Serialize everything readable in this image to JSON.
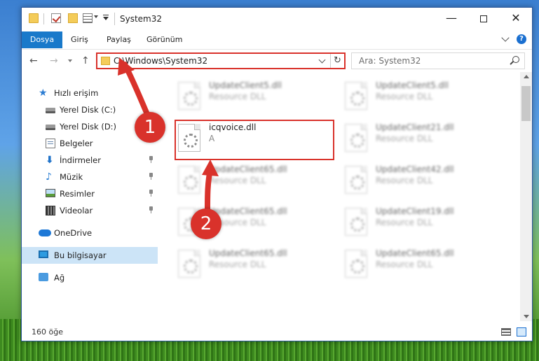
{
  "window": {
    "title": "System32",
    "minimize": "—",
    "close": "✕"
  },
  "ribbon": {
    "tabs": [
      "Dosya",
      "Giriş",
      "Paylaş",
      "Görünüm"
    ],
    "help": "?"
  },
  "address": {
    "path": "C:\\Windows\\System32",
    "refresh": "↻",
    "search_placeholder": "Ara: System32"
  },
  "nav": {
    "back": "←",
    "forward": "→",
    "up": "↑"
  },
  "sidebar": {
    "items": [
      {
        "label": "Hızlı erişim",
        "icon": "star-icon"
      },
      {
        "label": "Yerel Disk (C:)",
        "icon": "drive-icon"
      },
      {
        "label": "Yerel Disk (D:)",
        "icon": "drive-icon"
      },
      {
        "label": "Belgeler",
        "icon": "documents-icon"
      },
      {
        "label": "İndirmeler",
        "icon": "downloads-icon"
      },
      {
        "label": "Müzik",
        "icon": "music-icon"
      },
      {
        "label": "Resimler",
        "icon": "pictures-icon"
      },
      {
        "label": "Videolar",
        "icon": "videos-icon"
      },
      {
        "label": "OneDrive",
        "icon": "cloud-icon"
      },
      {
        "label": "Bu bilgisayar",
        "icon": "computer-icon"
      },
      {
        "label": "Ağ",
        "icon": "network-icon"
      }
    ],
    "icon_glyphs": {
      "star": "★",
      "download": "⬇",
      "music": "♪"
    }
  },
  "files": {
    "col1": [
      {
        "name": "UpdateClient5.dll",
        "desc": "Resource DLL"
      },
      {
        "name": "icqvoice.dll",
        "desc": "A"
      },
      {
        "name": "UpdateClient65.dll",
        "desc": "Resource DLL"
      },
      {
        "name": "UpdateClient65.dll",
        "desc": "Resource DLL"
      },
      {
        "name": "UpdateClient65.dll",
        "desc": "Resource DLL"
      }
    ],
    "col2": [
      {
        "name": "UpdateClient5.dll",
        "desc": "Resource DLL"
      },
      {
        "name": "UpdateClient21.dll",
        "desc": "Resource DLL"
      },
      {
        "name": "UpdateClient42.dll",
        "desc": "Resource DLL"
      },
      {
        "name": "UpdateClient19.dll",
        "desc": "Resource DLL"
      },
      {
        "name": "UpdateClient65.dll",
        "desc": "Resource DLL"
      }
    ]
  },
  "status": {
    "item_count": "160 öğe"
  },
  "callouts": [
    "1",
    "2"
  ],
  "colors": {
    "highlight": "#d9322b",
    "file_tab": "#1979ca",
    "selected_nav": "#cce4f7"
  }
}
